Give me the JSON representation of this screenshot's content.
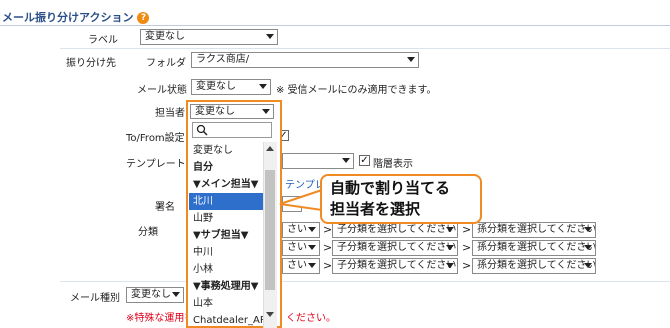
{
  "section": {
    "title": "メール振り分けアクション",
    "help_icon": "?"
  },
  "label_row": {
    "label": "ラベル",
    "value": "変更なし"
  },
  "sort_dest": {
    "label": "振り分け先",
    "folder_label": "フォルダ",
    "folder_value": "ラクス商店/",
    "mail_status_label": "メール状態",
    "mail_status_value": "変更なし",
    "mail_status_note": "※ 受信メールにのみ適用できます。",
    "assignee_label": "担当者",
    "assignee_value": "変更なし",
    "tofrom_label": "To/From設定",
    "template_label": "テンプレート",
    "hierarchy_label": "階層表示",
    "template_link": "テンプレ",
    "signature_label": "署名",
    "category_label": "分類"
  },
  "category_rows": [
    {
      "first": "さい",
      "second": "子分類を選択してください",
      "third": "孫分類を選択してください"
    },
    {
      "first": "さい",
      "second": "子分類を選択してください",
      "third": "孫分類を選択してください"
    },
    {
      "first": "さい",
      "second": "子分類を選択してください",
      "third": "孫分類を選択してください"
    }
  ],
  "dropdown": {
    "search_icon": "search-icon",
    "items": [
      {
        "text": "変更なし",
        "type": "item"
      },
      {
        "text": "自分",
        "type": "group"
      },
      {
        "text": "▼メイン担当▼",
        "type": "group"
      },
      {
        "text": "北川",
        "type": "selected"
      },
      {
        "text": "山野",
        "type": "item"
      },
      {
        "text": "▼サブ担当▼",
        "type": "group"
      },
      {
        "text": "中川",
        "type": "item"
      },
      {
        "text": "小林",
        "type": "item"
      },
      {
        "text": "▼事務処理用▼",
        "type": "group"
      },
      {
        "text": "山本",
        "type": "item"
      },
      {
        "text": "Chatdealer_API",
        "type": "item"
      }
    ]
  },
  "callout": {
    "line1": "自動で割り当てる",
    "line2": "担当者を選択"
  },
  "mail_type": {
    "label": "メール種別",
    "value": "変更なし"
  },
  "warning": {
    "text": "※特殊な運用を",
    "text2": "ください。"
  },
  "colors": {
    "accent": "#f08a22",
    "title": "#2a4f88",
    "selected": "#2f6fcc",
    "warning": "#e0001a"
  }
}
